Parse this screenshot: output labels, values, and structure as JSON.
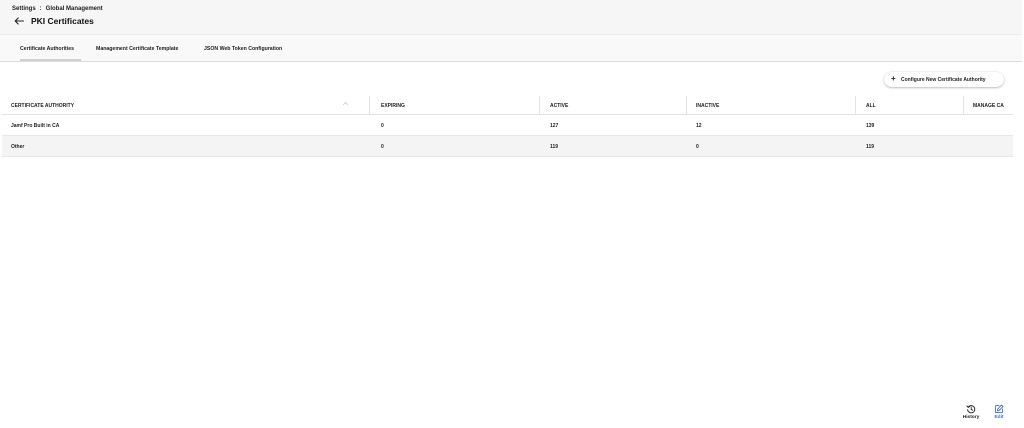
{
  "header": {
    "breadcrumb_parent": "Settings",
    "breadcrumb_sep": ":",
    "breadcrumb_current": "Global Management",
    "title": "PKI Certificates"
  },
  "tabs": [
    {
      "label": "Certificate Authorities",
      "active": true
    },
    {
      "label": "Management Certificate Template",
      "active": false
    },
    {
      "label": "JSON Web Token Configuration",
      "active": false
    }
  ],
  "actions": {
    "configure_plus": "+",
    "configure_label": "Configure New Certificate Authority"
  },
  "table": {
    "columns": [
      "CERTIFICATE AUTHORITY",
      "EXPIRING",
      "ACTIVE",
      "INACTIVE",
      "ALL",
      "MANAGE CA"
    ],
    "rows": [
      {
        "name": "Jamf Pro Built in CA",
        "expiring": "0",
        "active": "127",
        "inactive": "12",
        "all": "139"
      },
      {
        "name": "Other",
        "expiring": "0",
        "active": "119",
        "inactive": "0",
        "all": "119"
      }
    ]
  },
  "footer": {
    "history_label": "History",
    "edit_label": "Edit"
  },
  "colors": {
    "accent": "#3b6fd6",
    "header_bg": "#f6f6f7",
    "row_alt_bg": "#f4f4f5"
  },
  "icons": [
    "back-arrow-icon",
    "sort-ascending-icon",
    "history-icon",
    "edit-icon"
  ]
}
